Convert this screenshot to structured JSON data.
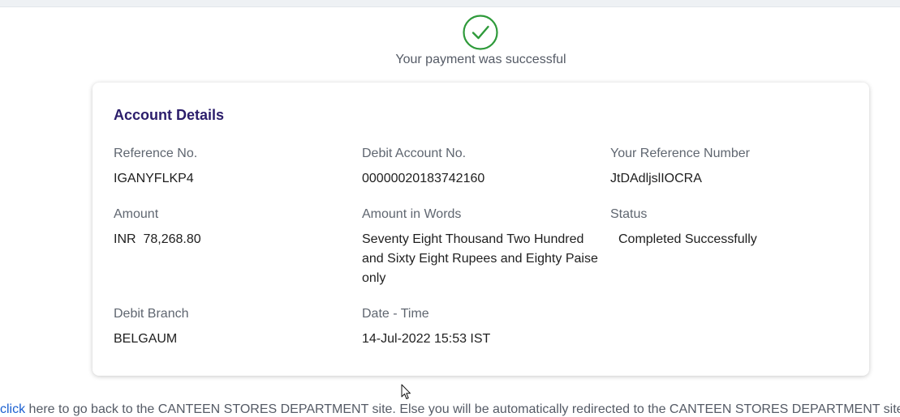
{
  "status_message": "Your payment was successful",
  "card": {
    "title": "Account Details",
    "fields": {
      "reference_no": {
        "label": "Reference No.",
        "value": "IGANYFLKP4"
      },
      "debit_account_no": {
        "label": "Debit Account No.",
        "value": "00000020183742160"
      },
      "your_reference_number": {
        "label": "Your Reference Number",
        "value": "JtDAdljslIOCRA"
      },
      "amount": {
        "label": "Amount",
        "value": "INR  78,268.80"
      },
      "amount_in_words": {
        "label": "Amount in Words",
        "value": "Seventy Eight Thousand Two Hundred and Sixty Eight Rupees and Eighty Paise only"
      },
      "status": {
        "label": "Status",
        "value": "Completed Successfully"
      },
      "debit_branch": {
        "label": "Debit Branch",
        "value": "BELGAUM"
      },
      "date_time": {
        "label": "Date - Time",
        "value": "14-Jul-2022 15:53 IST"
      }
    }
  },
  "footer": {
    "link_text": "click",
    "text": " here to go back to the CANTEEN STORES DEPARTMENT site. Else you will be automatically redirected to the CANTEEN STORES DEPARTMENT site in"
  },
  "colors": {
    "success_green": "#2e9a3a",
    "title_purple": "#2b1d6b",
    "link_blue": "#1a5fd0"
  },
  "icons": {
    "success": "check-circle-icon",
    "cursor": "mouse-pointer-icon"
  }
}
